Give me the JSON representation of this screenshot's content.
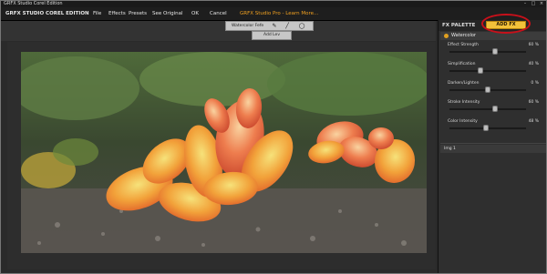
{
  "window": {
    "title": "GRFX Studio Corel Edition"
  },
  "menu": {
    "brand": "GRFX STUDIO COREL EDITION",
    "file": "File",
    "effects": "Effects",
    "presets": "Presets",
    "see_original": "See Original",
    "ok": "OK",
    "cancel": "Cancel",
    "promo": "GRFX Studio Pro - Learn More..."
  },
  "toolbar": {
    "layer_name": "Watercolor Fefe",
    "add_layer": "Add Lev"
  },
  "panel": {
    "title": "FX PALETTE",
    "add_fx": "ADD   FX",
    "effect_name": "Watercolor",
    "params": [
      {
        "label": "Effect Strength",
        "value": "60 %",
        "fraction": 0.6
      },
      {
        "label": "Simplification",
        "value": "40 %",
        "fraction": 0.4
      },
      {
        "label": "Darken/Lighten",
        "value": "0 %",
        "fraction": 0.5
      },
      {
        "label": "Stroke Intensity",
        "value": "60 %",
        "fraction": 0.6
      },
      {
        "label": "Color Intensity",
        "value": "48 %",
        "fraction": 0.48
      }
    ],
    "image_section": "Img 1"
  },
  "colors": {
    "accent": "#f2c23a",
    "highlight_ring": "#c8101a",
    "promo": "#f0a020"
  },
  "icons": [
    "brush-icon",
    "pen-icon",
    "ellipse-icon",
    "effect-dot-icon",
    "minimize-icon",
    "maximize-icon",
    "close-icon"
  ]
}
